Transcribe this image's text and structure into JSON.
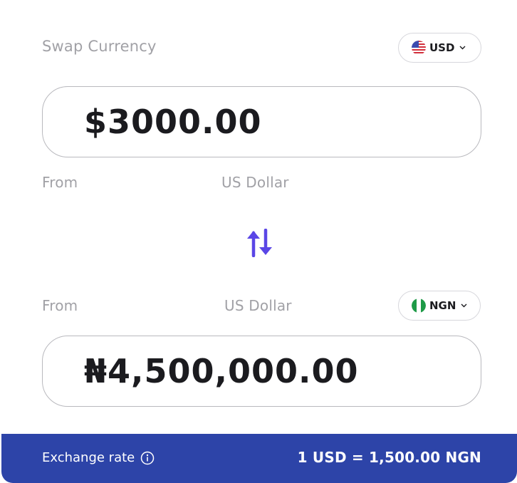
{
  "header": {
    "title": "Swap Currency"
  },
  "from": {
    "currency_code": "USD",
    "flag_icon": "us-flag-icon",
    "amount": "$3000.00",
    "direction_label": "From",
    "currency_name": "US Dollar"
  },
  "swap": {
    "icon": "swap-arrows-icon"
  },
  "to": {
    "currency_code": "NGN",
    "flag_icon": "nigeria-flag-icon",
    "amount": "₦4,500,000.00",
    "direction_label": "From",
    "currency_name": "US Dollar"
  },
  "exchange": {
    "label": "Exchange rate",
    "info_icon": "info-icon",
    "rate": "1 USD = 1,500.00 NGN"
  },
  "colors": {
    "accent_purple": "#5a46e6",
    "rate_bar_bg": "#2d44a8",
    "muted_text": "#a1a1a6"
  }
}
